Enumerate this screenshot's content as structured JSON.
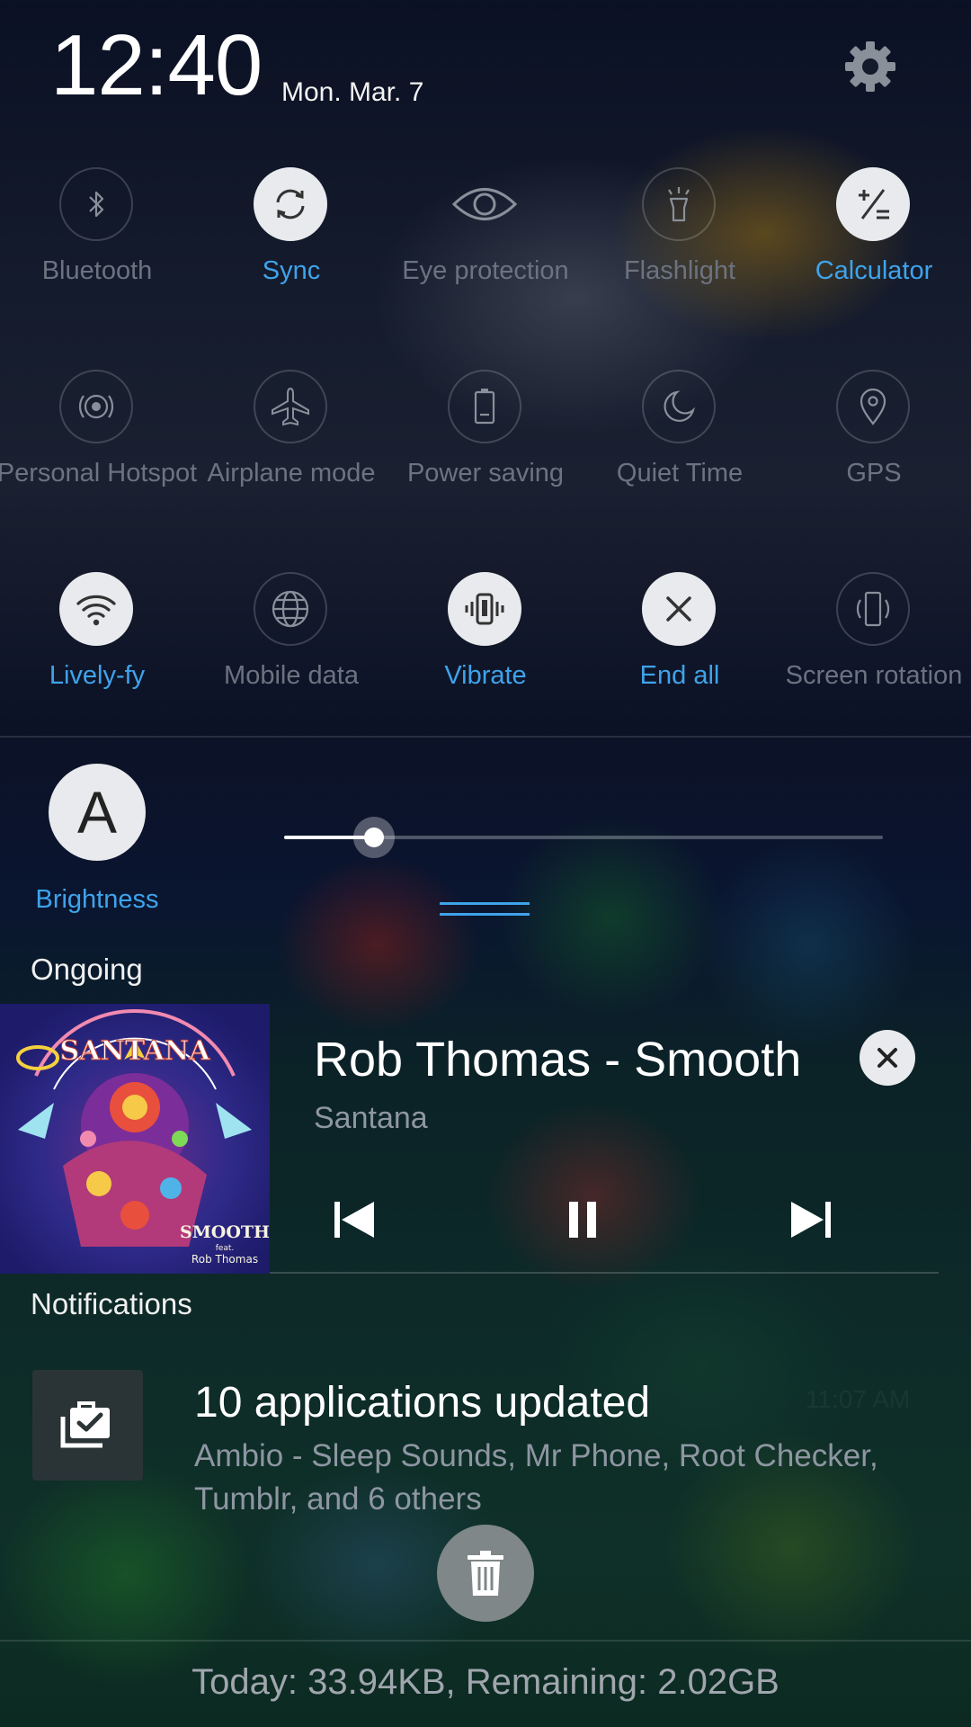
{
  "status": {
    "time": "12:40",
    "date": "Mon. Mar. 7"
  },
  "toggles": [
    {
      "label": "Bluetooth",
      "icon": "bluetooth-icon",
      "active": false
    },
    {
      "label": "Sync",
      "icon": "sync-icon",
      "active": true
    },
    {
      "label": "Eye protection",
      "icon": "eye-icon",
      "active": false
    },
    {
      "label": "Flashlight",
      "icon": "flashlight-icon",
      "active": false
    },
    {
      "label": "Calculator",
      "icon": "calculator-icon",
      "active": true
    },
    {
      "label": "Personal Hotspot",
      "icon": "hotspot-icon",
      "active": false
    },
    {
      "label": "Airplane mode",
      "icon": "airplane-icon",
      "active": false
    },
    {
      "label": "Power saving",
      "icon": "battery-icon",
      "active": false
    },
    {
      "label": "Quiet Time",
      "icon": "moon-icon",
      "active": false
    },
    {
      "label": "GPS",
      "icon": "location-pin-icon",
      "active": false
    },
    {
      "label": "Lively-fy",
      "icon": "wifi-icon",
      "active": true
    },
    {
      "label": "Mobile data",
      "icon": "globe-icon",
      "active": false
    },
    {
      "label": "Vibrate",
      "icon": "vibrate-icon",
      "active": true
    },
    {
      "label": "End all",
      "icon": "close-icon",
      "active": true
    },
    {
      "label": "Screen rotation",
      "icon": "rotation-icon",
      "active": false
    }
  ],
  "brightness": {
    "label": "Brightness",
    "icon_letter": "A",
    "level": 0.15
  },
  "ongoing": {
    "section_title": "Ongoing",
    "media": {
      "title": "Rob Thomas - Smooth",
      "artist": "Santana",
      "album_art_text": "SANTANA",
      "album_art_subtitle": "SMOOTH",
      "album_art_feat": "feat.",
      "album_art_credit": "Rob Thomas"
    }
  },
  "notifications": {
    "section_title": "Notifications",
    "items": [
      {
        "title": "10 applications updated",
        "time": "11:07 AM",
        "body": "Ambio - Sleep Sounds, Mr Phone, Root Checker, Tumblr, and 6 others",
        "icon": "app-update-icon"
      }
    ]
  },
  "footer": {
    "data_usage": "Today: 33.94KB, Remaining: 2.02GB"
  },
  "colors": {
    "accent": "#3fa3ea",
    "inactive_label": "#6c7380",
    "active_circle": "#e9eaed"
  }
}
